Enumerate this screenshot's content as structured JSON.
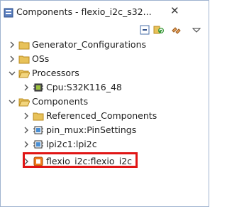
{
  "panel": {
    "title": "Components - flexio_i2c_s32..."
  },
  "toolbar": {
    "icons": [
      "collapse-all-icon",
      "refresh-icon",
      "link-icon",
      "view-menu-icon"
    ]
  },
  "tree": {
    "items": [
      {
        "label": "Generator_Configurations",
        "expanded": false,
        "icon": "folder-icon"
      },
      {
        "label": "OSs",
        "expanded": false,
        "icon": "folder-icon"
      },
      {
        "label": "Processors",
        "expanded": true,
        "icon": "folder-icon"
      },
      {
        "label": "Cpu:S32K116_48",
        "expanded": false,
        "icon": "cpu-icon"
      },
      {
        "label": "Components",
        "expanded": true,
        "icon": "folder-icon"
      },
      {
        "label": "Referenced_Components",
        "expanded": false,
        "icon": "folder-icon"
      },
      {
        "label": "pin_mux:PinSettings",
        "expanded": false,
        "icon": "component-icon"
      },
      {
        "label": "lpi2c1:lpi2c",
        "expanded": false,
        "icon": "component-icon"
      },
      {
        "label": "flexio_i2c:flexio_i2c",
        "expanded": false,
        "icon": "component-orange-icon",
        "highlighted": true
      }
    ]
  },
  "colors": {
    "highlight_border": "#e01515",
    "folder": "#e8c25a"
  }
}
